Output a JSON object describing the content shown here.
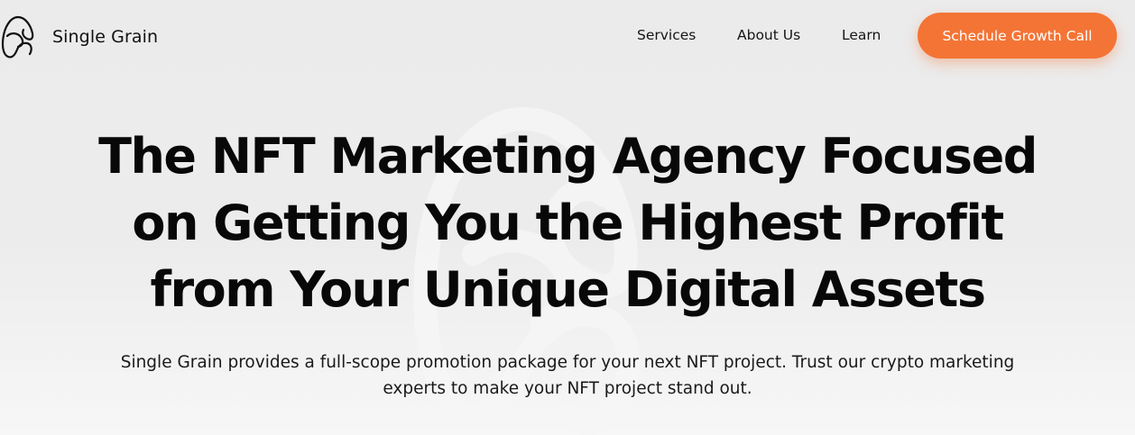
{
  "brand": {
    "name": "Single Grain",
    "logo_icon": "single-grain-logo-icon"
  },
  "nav": {
    "items": [
      {
        "label": "Services"
      },
      {
        "label": "About Us"
      },
      {
        "label": "Learn"
      }
    ],
    "cta_label": "Schedule Growth Call"
  },
  "hero": {
    "title": "The NFT Marketing Agency Focused on Getting You the Highest Profit from Your Unique Digital Assets",
    "subtitle": "Single Grain provides a full-scope promotion package for your next NFT project. Trust our crypto marketing experts to make your NFT project stand out."
  },
  "colors": {
    "accent": "#f47435",
    "background": "#ebebeb",
    "text": "#0b0b0b"
  }
}
